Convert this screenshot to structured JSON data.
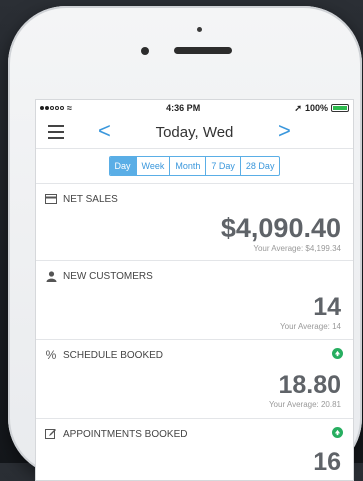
{
  "status": {
    "time": "4:36 PM",
    "battery": "100%"
  },
  "nav": {
    "title": "Today, Wed",
    "prev": "<",
    "next": ">"
  },
  "segments": [
    "Day",
    "Week",
    "Month",
    "7 Day",
    "28 Day"
  ],
  "selected_segment": "Day",
  "cards": [
    {
      "label": "NET SALES",
      "value": "$4,090.40",
      "average": "Your Average: $4,199.34",
      "icon": "card-icon",
      "trend": ""
    },
    {
      "label": "NEW CUSTOMERS",
      "value": "14",
      "average": "Your Average: 14",
      "icon": "user-icon",
      "trend": ""
    },
    {
      "label": "SCHEDULE BOOKED",
      "value": "18.80",
      "average": "Your Average: 20.81",
      "icon": "percent-icon",
      "trend": "up"
    },
    {
      "label": "APPOINTMENTS BOOKED",
      "value": "16",
      "average": "",
      "icon": "edit-icon",
      "trend": "up"
    }
  ],
  "colors": {
    "accent": "#3a97dc",
    "up": "#27ae60"
  }
}
